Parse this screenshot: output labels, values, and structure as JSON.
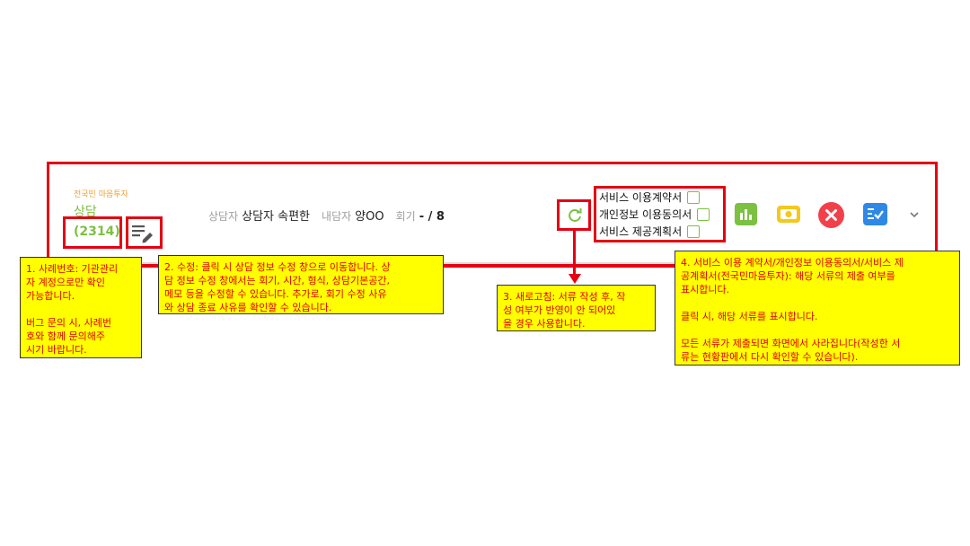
{
  "header": {
    "tag": "전국민 마음투자",
    "service": "상담",
    "case_number": "(2314)",
    "counselor_label": "상담자",
    "counselor_value": "상담자 속편한",
    "client_label": "내담자",
    "client_value": "양OO",
    "session_label": "회기",
    "session_value": "- / 8"
  },
  "documents": [
    {
      "label": "서비스 이용계약서",
      "checked": false
    },
    {
      "label": "개인정보 이용동의서",
      "checked": false
    },
    {
      "label": "서비스 제공계획서",
      "checked": false
    }
  ],
  "icons": {
    "refresh": "refresh-icon",
    "chart": "chart-icon",
    "cash": "cash-icon",
    "close": "close-icon",
    "checklist": "checklist-icon",
    "expand": "chevron-down-icon"
  },
  "colors": {
    "accent_red": "#e50012",
    "brand_green": "#7cc142",
    "note_yellow": "#ffff00",
    "close_red": "#f2404a",
    "list_blue": "#2f88e6"
  },
  "notes": {
    "note1": "1. 사례번호: 기관관리\n자 계정으로만 확인\n가능합니다.\n\n버그 문의 시, 사례번\n호와 함께 문의해주\n시기 바랍니다.",
    "note2": "2. 수정: 클릭 시 상담 정보 수정 창으로 이동합니다. 상\n담 정보 수정 창에서는 회기, 시간, 형식, 상담기본공간,\n메모 등을 수정할 수 있습니다. 추가로, 회기 수정 사유\n와 상담 종료 사유를 확인할 수 있습니다.",
    "note3": "3. 새로고침: 서류 작성 후, 작\n성 여부가 반영이 안 되어있\n을 경우 사용합니다.",
    "note4": "4. 서비스 이용 계약서/개인정보 이용동의서/서비스 제\n공계획서(전국민마음투자): 해당 서류의 제출 여부를\n표시합니다.\n\n클릭 시, 해당 서류를 표시합니다.\n\n모든 서류가 제출되면 화면에서 사라집니다(작성한 서\n류는 현황판에서 다시 확인할 수 있습니다)."
  }
}
